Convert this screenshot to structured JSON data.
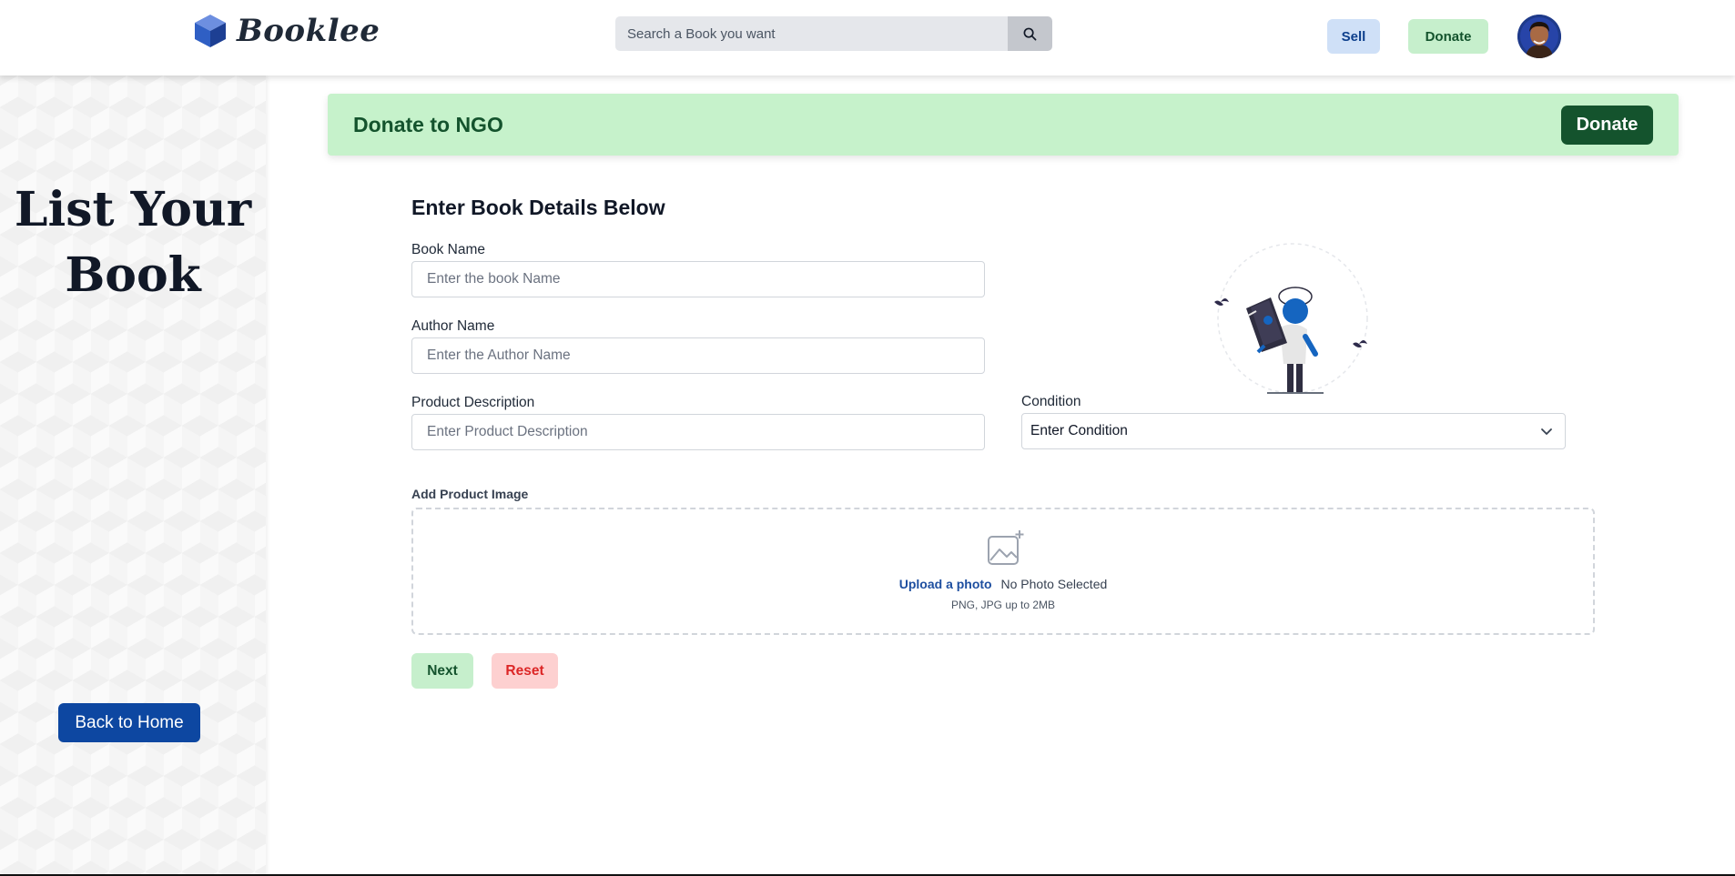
{
  "header": {
    "logo_text": "Booklee",
    "search_placeholder": "Search a Book you want",
    "sell_label": "Sell",
    "donate_label": "Donate"
  },
  "sidebar": {
    "title_line1": "List Your",
    "title_line2": "Book",
    "back_label": "Back to Home"
  },
  "banner": {
    "title": "Donate to NGO",
    "button_label": "Donate"
  },
  "form": {
    "heading": "Enter Book Details Below",
    "book_name_label": "Book Name",
    "book_name_placeholder": "Enter the book Name",
    "author_label": "Author Name",
    "author_placeholder": "Enter the Author Name",
    "description_label": "Product Description",
    "description_placeholder": "Enter Product Description",
    "condition_label": "Condition",
    "condition_value": "Enter Condition",
    "image_label": "Add Product Image",
    "upload_link": "Upload a photo",
    "upload_status": "No Photo Selected",
    "upload_hint": "PNG, JPG up to 2MB",
    "next_label": "Next",
    "reset_label": "Reset"
  },
  "colors": {
    "primary_blue": "#0d47a1",
    "green_light": "#c6efcc",
    "green_dark": "#14532d",
    "red_light": "#fdd0d0",
    "red_text": "#dc2626"
  }
}
